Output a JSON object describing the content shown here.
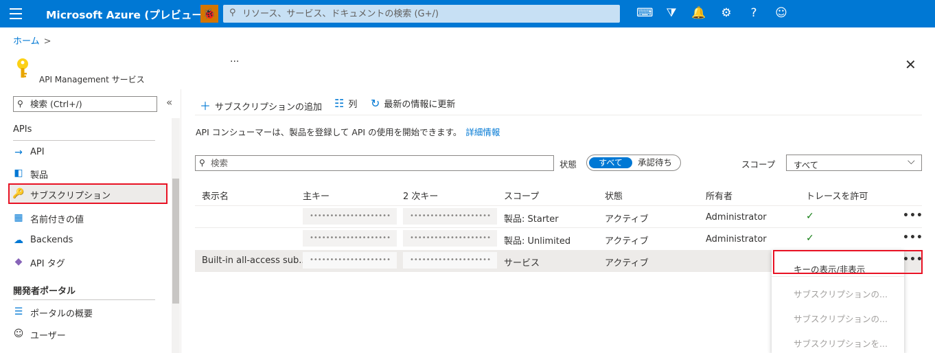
{
  "topbar": {
    "brand": "Microsoft Azure (プレビュー)",
    "search_placeholder": "リソース、サービス、ドキュメントの検索 (G+/)",
    "icons": [
      "menu-icon",
      "bug-icon",
      "search-icon",
      "cloud-shell-icon",
      "directory-filter-icon",
      "notifications-icon",
      "settings-icon",
      "help-icon",
      "feedback-icon"
    ]
  },
  "breadcrumb": {
    "home": "ホーム",
    "separator": ">"
  },
  "resource": {
    "type_label": "API Management サービス",
    "title_ellipsis": "···",
    "close": "✕"
  },
  "sidebar": {
    "search_placeholder": "検索 (Ctrl+/)",
    "collapse": "«",
    "section_apis": "APIs",
    "items": [
      {
        "label": "API",
        "icon": "api-icon"
      },
      {
        "label": "製品",
        "icon": "product-icon"
      },
      {
        "label": "サブスクリプション",
        "icon": "key-icon"
      },
      {
        "label": "名前付きの値",
        "icon": "named-values-icon"
      },
      {
        "label": "Backends",
        "icon": "backends-icon"
      },
      {
        "label": "API タグ",
        "icon": "tag-icon"
      }
    ],
    "section_portal": "開発者ポータル",
    "portal_items": [
      {
        "label": "ポータルの概要",
        "icon": "portal-overview-icon"
      },
      {
        "label": "ユーザー",
        "icon": "user-icon"
      }
    ]
  },
  "commands": {
    "add": "サブスクリプションの追加",
    "columns": "列",
    "refresh": "最新の情報に更新"
  },
  "info": {
    "text": "API コンシューマーは、製品を登録して API の使用を開始できます。",
    "link": "詳細情報"
  },
  "filters": {
    "search_placeholder": "検索",
    "state_label": "状態",
    "toggle_all": "すべて",
    "toggle_pending": "承認待ち",
    "scope_label": "スコープ",
    "scope_value": "すべて"
  },
  "table": {
    "headers": [
      "表示名",
      "主キー",
      "2 次キー",
      "スコープ",
      "状態",
      "所有者",
      "トレースを許可"
    ],
    "rows": [
      {
        "name": "",
        "primary": "••••••••••••••••••••",
        "secondary": "••••••••••••••••••••",
        "scope": "製品: Starter",
        "state": "アクティブ",
        "owner": "Administrator",
        "trace": "✓",
        "more": "•••"
      },
      {
        "name": "",
        "primary": "••••••••••••••••••••",
        "secondary": "••••••••••••••••••••",
        "scope": "製品: Unlimited",
        "state": "アクティブ",
        "owner": "Administrator",
        "trace": "✓",
        "more": "•••"
      },
      {
        "name": "Built-in all-access sub...",
        "primary": "••••••••••••••••••••",
        "secondary": "••••••••••••••••••••",
        "scope": "サービス",
        "state": "アクティブ",
        "owner": "",
        "trace": "",
        "more": "•••"
      }
    ]
  },
  "context_menu": {
    "items": [
      "キーの表示/非表示",
      "サブスクリプションの...",
      "サブスクリプションの...",
      "サブスクリプションを..."
    ]
  }
}
